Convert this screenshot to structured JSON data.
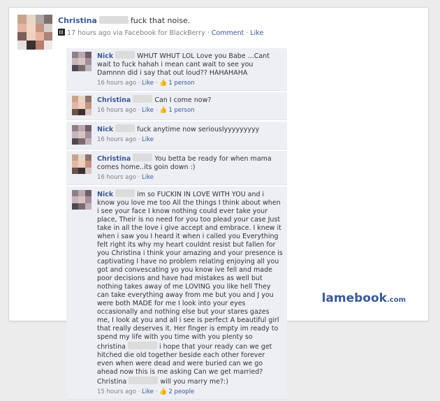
{
  "post": {
    "author": "Christina",
    "text": "fuck that noise.",
    "time": "17 hours ago via Facebook for BlackBerry",
    "comment_link": "Comment",
    "like_link": "Like"
  },
  "comments": [
    {
      "author": "Nick",
      "text": "WHUT WHUT LOL Love you Babe ...Cant wait to fuck hahah i mean cant wait to see you Damnnn did i say that out loud?? HAHAHAHA",
      "time": "16 hours ago",
      "like": "Like",
      "likes": "1 person"
    },
    {
      "author": "Christina",
      "text": "Can I come now?",
      "time": "16 hours ago",
      "like": "Like",
      "likes": "1 person"
    },
    {
      "author": "Nick",
      "text": "fuck anytime now seriouslyyyyyyyyy",
      "time": "16 hours ago",
      "like": "Like",
      "likes": ""
    },
    {
      "author": "Christina",
      "text": "You betta be ready for when mama comes home..its goin down :)",
      "time": "16 hours ago",
      "like": "Like",
      "likes": ""
    },
    {
      "author": "Nick",
      "text": "im so FUCKIN IN LOVE WITH YOU and i know you love me too All the things I think about when i see your face I know nothing could ever take your place, Their is no need for you too plead your case Just take in all the love i give accept and embrace. I knew it when i saw you I heard it when i called you Everything felt right its why my heart couldnt resist but fallen for you Christina i think your amazing and your presence is captivating I have no problem relating enjoying all you got and convescating yo you know ive fell and made poor decisions and have had mistakes as well but nothing takes away of me LOVING you like hell They can take everything away from me but you and J you were both MADE for me I look into your eyes occasionally and nothing else but your stares gazes me, I look at you and all i see is perfect A beautiful girl that really deserves it. Her finger is empty im ready to spend my life with you time with you plenty so christina",
      "text2": "i hope that your ready can we get hitched die old together beside each other forever even when were dead and were buried can we go ahead now this is me asking Can we get married? Christina",
      "text3": "will you marry me?:)",
      "time": "15 hours ago",
      "like": "Like",
      "likes": "2 people"
    }
  ],
  "watermark": {
    "main": "lamebook",
    "suffix": ".com"
  },
  "icons": {
    "blackberry": "blackberry-icon",
    "thumbs_up": "thumbs-up-icon"
  }
}
